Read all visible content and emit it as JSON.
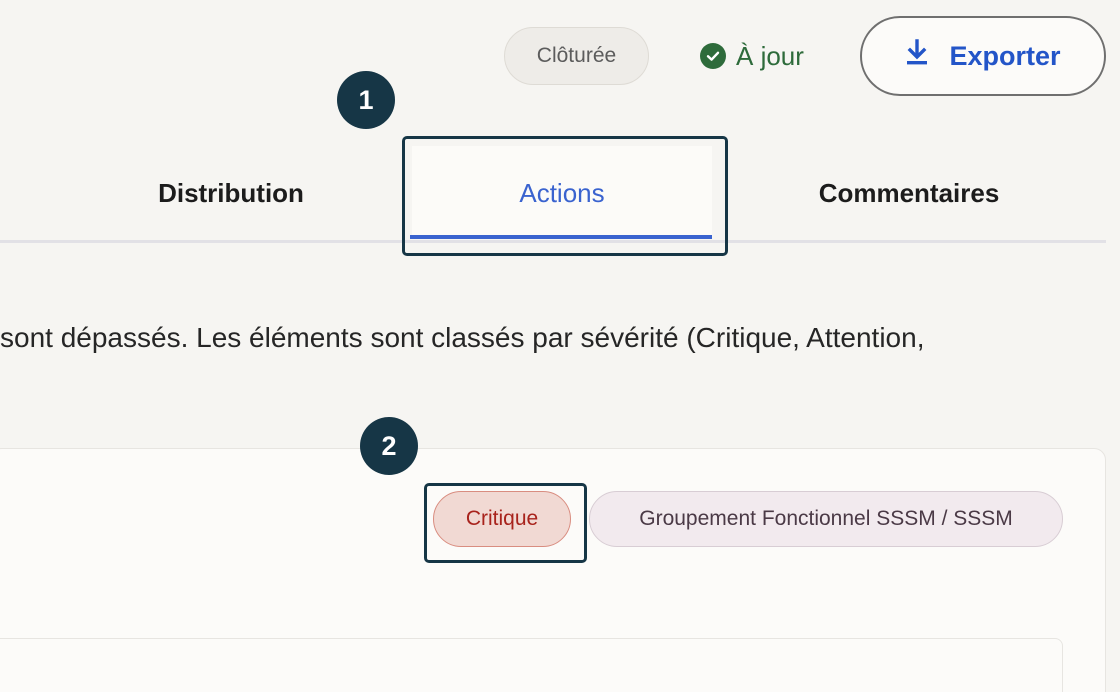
{
  "header": {
    "status_label": "Clôturée",
    "sync_label": "À jour",
    "export_label": "Exporter"
  },
  "markers": [
    "1",
    "2"
  ],
  "tabs": [
    {
      "label": "Distribution",
      "active": false
    },
    {
      "label": "Actions",
      "active": true
    },
    {
      "label": "Commentaires",
      "active": false
    }
  ],
  "description": "sont dépassés. Les éléments sont classés par sévérité (Critique, Attention,",
  "item": {
    "severity_badge": "Critique",
    "group_badge": "Groupement Fonctionnel SSSM / SSSM"
  },
  "colors": {
    "accent": "#3a63cf",
    "marker": "#163646",
    "success": "#2e6b3b",
    "critical": "#a8231c"
  }
}
